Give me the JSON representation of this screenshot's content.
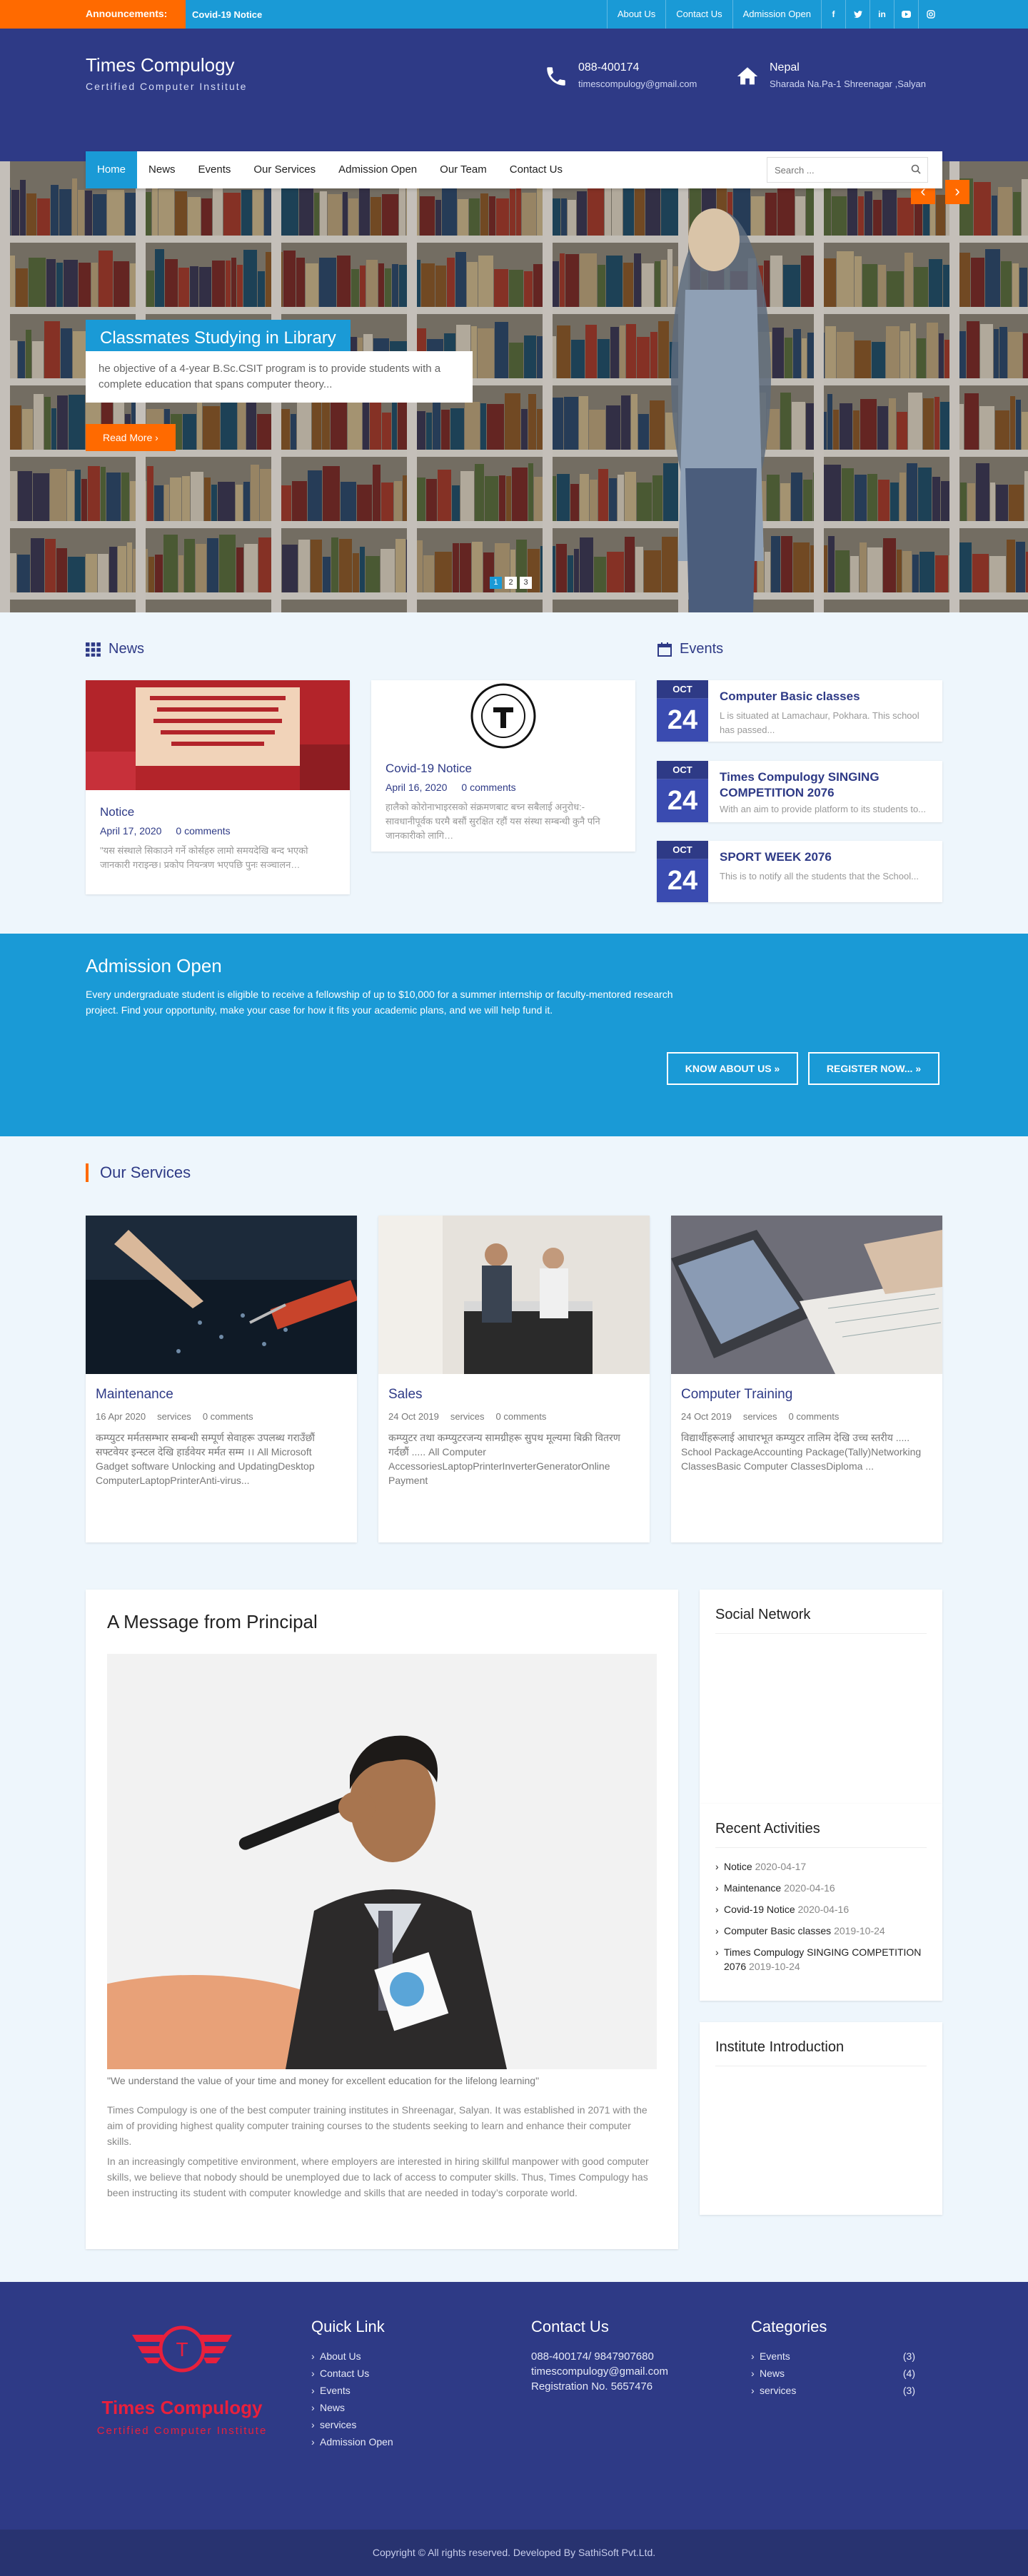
{
  "topbar": {
    "announcement_label": "Announcements:",
    "announcement_text": "Covid-19 Notice",
    "links": [
      "About Us",
      "Contact Us",
      "Admission Open"
    ],
    "social": [
      "f",
      "t",
      "in",
      "yt",
      "ig"
    ]
  },
  "header": {
    "title": "Times Compulogy",
    "subtitle": "Certified Computer Institute",
    "phone": "088-400174",
    "email": "timescompulogy@gmail.com",
    "location_title": "Nepal",
    "location_detail": "Sharada Na.Pa-1 Shreenagar ,Salyan"
  },
  "nav": {
    "items": [
      "Home",
      "News",
      "Events",
      "Our Services",
      "Admission Open",
      "Our Team",
      "Contact Us"
    ],
    "search_placeholder": "Search ..."
  },
  "hero": {
    "title": "Classmates Studying in Library",
    "text": "he objective of a 4-year B.Sc.CSIT program is to provide students with a complete education that spans computer theory...",
    "read_more": "Read More ›",
    "prev": "‹",
    "next": "›",
    "pages": [
      "1",
      "2",
      "3"
    ]
  },
  "news": {
    "heading": "News",
    "items": [
      {
        "title": "Notice",
        "date": "April 17, 2020",
        "comments": "0 comments",
        "excerpt": "\"यस संस्थाले सिकाउने गर्ने कोर्सहरु लामो समयदेखि बन्द भएको जानकारी गराइन्छ। प्रकोप नियन्त्रण भएपछि पुनः सञ्चालन…"
      },
      {
        "title": "Covid-19 Notice",
        "date": "April 16, 2020",
        "comments": "0 comments",
        "excerpt": "हालैको कोरोनाभाइरसको संक्रमणबाट बच्न सबैलाई अनुरोध:- सावधानीपूर्वक घरमै बसौं सुरक्षित रहौं यस संस्था सम्बन्धी कुनै पनि जानकारीको लागि…"
      }
    ]
  },
  "events": {
    "heading": "Events",
    "items": [
      {
        "month": "OCT",
        "day": "24",
        "title": "Computer Basic classes",
        "text": "L is situated at Lamachaur, Pokhara. This school has passed..."
      },
      {
        "month": "OCT",
        "day": "24",
        "title": "Times Compulogy SINGING COMPETITION 2076",
        "text": "With an aim to provide platform to its students to..."
      },
      {
        "month": "OCT",
        "day": "24",
        "title": "SPORT WEEK 2076",
        "text": "This is to notify all the students that the School..."
      }
    ]
  },
  "admission": {
    "title": "Admission Open",
    "text": "Every undergraduate student is eligible to receive a fellowship of up to $10,000 for a summer internship or faculty-mentored research project. Find your opportunity, make your case for how it fits your academic plans, and we will help fund it.",
    "btn_about": "KNOW ABOUT US »",
    "btn_register": "REGISTER NOW... »"
  },
  "services": {
    "heading": "Our Services",
    "items": [
      {
        "title": "Maintenance",
        "date": "16 Apr 2020",
        "category": "services",
        "comments": "0 comments",
        "excerpt": "कम्प्युटर मर्मतसम्भार सम्बन्धी सम्पूर्ण सेवाहरू उपलब्ध गराउँछौं सफ्टवेयर इन्स्टल देखि हार्डवेयर मर्मत सम्म ।। All Microsoft Gadget software Unlocking and UpdatingDesktop ComputerLaptopPrinterAnti-virus..."
      },
      {
        "title": "Sales",
        "date": "24 Oct 2019",
        "category": "services",
        "comments": "0 comments",
        "excerpt": "कम्प्युटर तथा कम्प्युटरजन्य सामग्रीहरू सुपथ मूल्यमा बिक्री वितरण गर्दछौं ..... All Computer AccessoriesLaptopPrinterInverterGeneratorOnline Payment"
      },
      {
        "title": "Computer Training",
        "date": "24 Oct 2019",
        "category": "services",
        "comments": "0 comments",
        "excerpt": "विद्यार्थीहरूलाई आधारभूत कम्प्युटर तालिम देखि उच्च स्तरीय ..... School PackageAccounting Package(Tally)Networking ClassesBasic Computer ClassesDiploma ..."
      }
    ]
  },
  "principal": {
    "heading": "A Message from Principal",
    "quote": "\"We understand the value of your time and money for excellent education for the lifelong learning\"",
    "p1": "Times Compulogy is one of the best computer training institutes in Shreenagar, Salyan. It was established in 2071 with the aim of providing highest quality computer training courses to the students seeking to learn and enhance their computer skills.",
    "p2": "In an increasingly competitive environment, where employers are interested in hiring skillful manpower with good computer skills, we believe that nobody should be unemployed due to lack of access to computer skills. Thus, Times Compulogy has been instructing its student with computer knowledge and skills that are needed in today’s corporate world."
  },
  "sidebar": {
    "social_heading": "Social Network",
    "recent_heading": "Recent Activities",
    "recent": [
      {
        "title": "Notice",
        "date": "2020-04-17"
      },
      {
        "title": "Maintenance",
        "date": "2020-04-16"
      },
      {
        "title": "Covid-19 Notice",
        "date": "2020-04-16"
      },
      {
        "title": "Computer Basic classes",
        "date": "2019-10-24"
      },
      {
        "title": "Times Compulogy SINGING COMPETITION 2076",
        "date": "2019-10-24"
      }
    ],
    "intro_heading": "Institute Introduction"
  },
  "footer": {
    "logo_title": "Times Compulogy",
    "logo_subtitle": "Certified Computer Institute",
    "logo_letter": "T",
    "quick_heading": "Quick Link",
    "quick_links": [
      "About Us",
      "Contact Us",
      "Events",
      "News",
      "services",
      "Admission Open"
    ],
    "contact_heading": "Contact Us",
    "contact_lines": [
      "088-400174/ 9847907680",
      "timescompulogy@gmail.com",
      "Registration No. 5657476"
    ],
    "cat_heading": "Categories",
    "categories": [
      {
        "name": "Events",
        "count": "(3)"
      },
      {
        "name": "News",
        "count": "(4)"
      },
      {
        "name": "services",
        "count": "(3)"
      }
    ],
    "copyright": "Copyright © All rights reserved. Developed By SathiSoft Pvt.Ltd."
  },
  "colors": {
    "primary": "#2e3a86",
    "accent": "#1a9ad6",
    "orange": "#ff6a00",
    "footer_logo": "#e8203c"
  }
}
